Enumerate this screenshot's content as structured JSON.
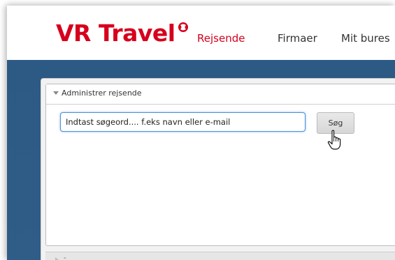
{
  "brand": {
    "logo_text": "VR Travel",
    "color": "#d6001c"
  },
  "nav": {
    "items": [
      {
        "label": "Rejsende",
        "active": true
      },
      {
        "label": "Firmaer",
        "active": false
      },
      {
        "label": "Mit bures",
        "active": false
      }
    ]
  },
  "panel": {
    "section_title": "Administrer rejsende",
    "search": {
      "value": "Indtast søgeord.... f.eks navn eller e-mail",
      "placeholder": "Indtast søgeord.... f.eks navn eller e-mail"
    },
    "search_button_label": "Søg",
    "collapsed_section_title": "-"
  },
  "colors": {
    "band": "#2d5a84",
    "active_nav": "#d6001c",
    "input_focus": "#4a90d9"
  },
  "icons": {
    "cursor": "hand-pointer-icon",
    "logo_mark": "vr-logo-mark-icon",
    "caret": "caret-down-icon"
  }
}
